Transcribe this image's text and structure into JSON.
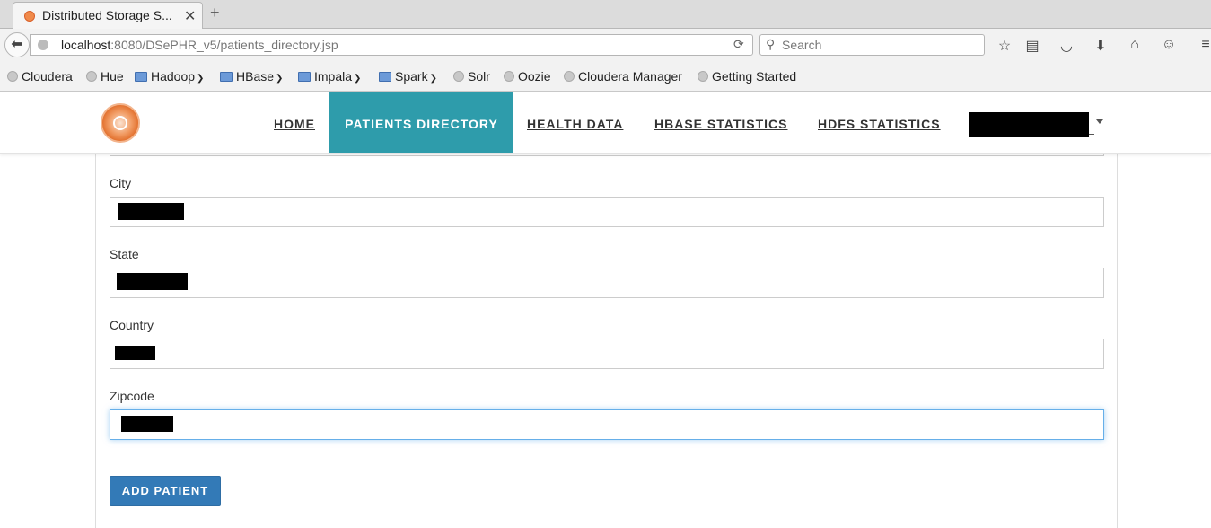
{
  "browser": {
    "tab_title": "Distributed Storage S...",
    "tab_close": "✕",
    "new_tab": "+",
    "url_host": "localhost",
    "url_rest": ":8080/DSePHR_v5/patients_directory.jsp",
    "search_placeholder": "Search",
    "toolbar_icons": [
      "back-icon",
      "reload-icon",
      "star-icon",
      "reading-list-icon",
      "pocket-icon",
      "download-icon",
      "home-icon",
      "chat-icon",
      "menu-icon"
    ]
  },
  "bookmarks": [
    {
      "label": "Cloudera",
      "kind": "site"
    },
    {
      "label": "Hue",
      "kind": "site"
    },
    {
      "label": "Hadoop",
      "kind": "folder"
    },
    {
      "label": "HBase",
      "kind": "folder"
    },
    {
      "label": "Impala",
      "kind": "folder"
    },
    {
      "label": "Spark",
      "kind": "folder"
    },
    {
      "label": "Solr",
      "kind": "site"
    },
    {
      "label": "Oozie",
      "kind": "site"
    },
    {
      "label": "Cloudera Manager",
      "kind": "site"
    },
    {
      "label": "Getting Started",
      "kind": "site"
    }
  ],
  "site_nav": {
    "home": "HOME",
    "patients_directory": "PATIENTS DIRECTORY",
    "health_data": "HEALTH DATA",
    "hbase_statistics": "HBASE STATISTICS",
    "hdfs_statistics": "HDFS STATISTICS",
    "active": "patients_directory",
    "accent_color": "#2e9cab"
  },
  "form": {
    "city_label": "City",
    "state_label": "State",
    "country_label": "Country",
    "zipcode_label": "Zipcode",
    "submit_label": "ADD PATIENT",
    "button_color": "#337ab7"
  }
}
